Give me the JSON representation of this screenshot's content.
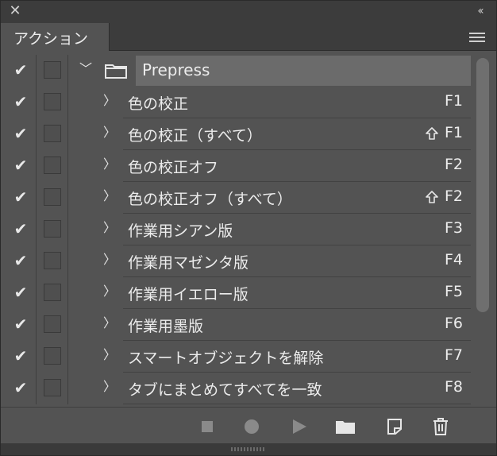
{
  "panel": {
    "tab_label": "アクション",
    "close_glyph": "✕",
    "collapse_glyph": "‹‹"
  },
  "icons": {
    "check": "✔",
    "chevron_right": "〉",
    "chevron_down": "﹀"
  },
  "folder": {
    "name": "Prepress",
    "checked": true,
    "expanded": true
  },
  "actions": [
    {
      "name": "色の校正",
      "key": "F1",
      "shift": false,
      "checked": true
    },
    {
      "name": "色の校正（すべて）",
      "key": "F1",
      "shift": true,
      "checked": true
    },
    {
      "name": "色の校正オフ",
      "key": "F2",
      "shift": false,
      "checked": true
    },
    {
      "name": "色の校正オフ（すべて）",
      "key": "F2",
      "shift": true,
      "checked": true
    },
    {
      "name": "作業用シアン版",
      "key": "F3",
      "shift": false,
      "checked": true
    },
    {
      "name": "作業用マゼンタ版",
      "key": "F4",
      "shift": false,
      "checked": true
    },
    {
      "name": "作業用イエロー版",
      "key": "F5",
      "shift": false,
      "checked": true
    },
    {
      "name": "作業用墨版",
      "key": "F6",
      "shift": false,
      "checked": true
    },
    {
      "name": "スマートオブジェクトを解除",
      "key": "F7",
      "shift": false,
      "checked": true
    },
    {
      "name": "タブにまとめてすべてを一致",
      "key": "F8",
      "shift": false,
      "checked": true
    }
  ],
  "toolbar": [
    {
      "name": "stop-icon",
      "label": "停止"
    },
    {
      "name": "record-icon",
      "label": "記録開始"
    },
    {
      "name": "play-icon",
      "label": "選択項目を実行"
    },
    {
      "name": "new-set-folder-icon",
      "label": "新規セットを作成"
    },
    {
      "name": "new-action-icon",
      "label": "新規アクションを作成"
    },
    {
      "name": "trash-icon",
      "label": "削除"
    }
  ],
  "colors": {
    "panel_bg": "#535353",
    "header_bg": "#3c3c3c",
    "selected_folder_bg": "#6b6b6b",
    "text": "#ececec"
  }
}
